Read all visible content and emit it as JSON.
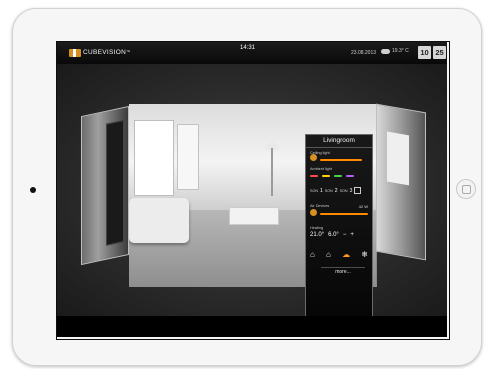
{
  "topbar": {
    "brand": "CUBEVISION",
    "tm": "™",
    "time": "14:31",
    "date": "23.08.2013",
    "temperature": "19.3° C",
    "hour": "10",
    "minute": "25",
    "weather_icon": "cloud-icon"
  },
  "control": {
    "room_name": "Livingroom",
    "ceiling_label": "Ceiling light",
    "ambient_label": "Ambient light",
    "son1_label": "SON",
    "son1_value": "1",
    "son2_label": "SON",
    "son2_value": "2",
    "son3_label": "SON",
    "son3_value": "3",
    "air_label": "Air Devices",
    "air_value": "42 W",
    "heating_label": "Heating",
    "heating_value": "21.0°",
    "heating_target": "6.0°",
    "minus": "−",
    "plus": "+",
    "more": "more...",
    "ceiling_level": 0.8,
    "ambient_colors": [
      "#ff4a4a",
      "#ffd400",
      "#43d64b",
      "#b35cff"
    ],
    "accent": "#ff8a00",
    "icons": [
      "home-icon",
      "house-icon",
      "weather-icon",
      "snowflake-icon"
    ]
  },
  "colors": {
    "accent": "#ff8a00",
    "screen_bg": "#050505",
    "device_frame": "#f6f6f6"
  }
}
